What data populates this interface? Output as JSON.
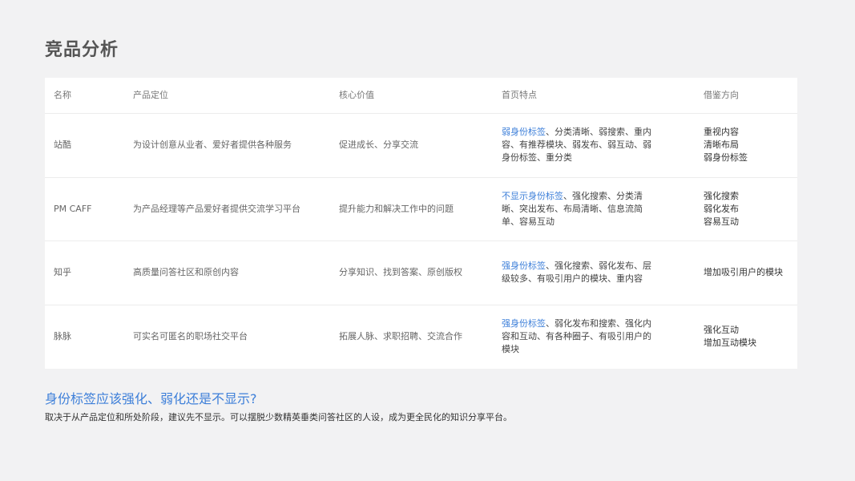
{
  "page": {
    "title": "竞品分析"
  },
  "table": {
    "headers": {
      "name": "名称",
      "position": "产品定位",
      "value": "核心价值",
      "features": "首页特点",
      "reference": "借鉴方向"
    },
    "rows": [
      {
        "name": "站酷",
        "position": "为设计创意从业者、爱好者提供各种服务",
        "value": "促进成长、分享交流",
        "features_highlight": "弱身份标签",
        "features_rest": "、分类清晰、弱搜索、重内容、有推荐模块、弱发布、弱互动、弱身份标签、重分类",
        "reference": "重视内容\n清晰布局\n弱身份标签"
      },
      {
        "name": "PM CAFF",
        "position": "为产品经理等产品爱好者提供交流学习平台",
        "value": "提升能力和解决工作中的问题",
        "features_highlight": "不显示身份标签",
        "features_rest": "、强化搜索、分类清晰、突出发布、布局清晰、信息流简单、容易互动",
        "reference": "强化搜索\n弱化发布\n容易互动"
      },
      {
        "name": "知乎",
        "position": "高质量问答社区和原创内容",
        "value": "分享知识、找到答案、原创版权",
        "features_highlight": "强身份标签",
        "features_rest": "、强化搜索、弱化发布、层级较多、有吸引用户的模块、重内容",
        "reference": "增加吸引用户的模块"
      },
      {
        "name": "脉脉",
        "position": "可实名可匿名的职场社交平台",
        "value": "拓展人脉、求职招聘、交流合作",
        "features_highlight": "强身份标签",
        "features_rest": "、弱化发布和搜索、强化内容和互动、有各种圈子、有吸引用户的模块",
        "reference": "强化互动\n增加互动模块"
      }
    ]
  },
  "conclusion": {
    "question": "身份标签应该强化、弱化还是不显示?",
    "answer": "取决于从产品定位和所处阶段，建议先不显示。可以摆脱少数精英垂类问答社区的人设，成为更全民化的知识分享平台。"
  },
  "colors": {
    "accent": "#3d7fd9",
    "background": "#f2f2f3",
    "table_bg": "#ffffff"
  }
}
